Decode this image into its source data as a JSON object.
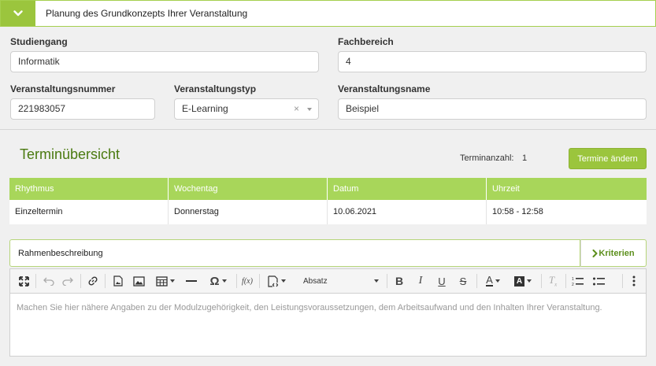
{
  "panel": {
    "title": "Planung des Grundkonzepts Ihrer Veranstaltung",
    "toggle_icon": "chevron-down-icon"
  },
  "form": {
    "studiengang": {
      "label": "Studiengang",
      "value": "Informatik"
    },
    "fachbereich": {
      "label": "Fachbereich",
      "value": "4"
    },
    "veranstaltungsnummer": {
      "label": "Veranstaltungsnummer",
      "value": "221983057"
    },
    "veranstaltungstyp": {
      "label": "Veranstaltungstyp",
      "value": "E-Learning",
      "clear": "×"
    },
    "veranstaltungsname": {
      "label": "Veranstaltungsname",
      "value": "Beispiel"
    }
  },
  "termine": {
    "title": "Terminübersicht",
    "count_label": "Terminanzahl:",
    "count_value": "1",
    "change_button": "Termine ändern",
    "columns": [
      "Rhythmus",
      "Wochentag",
      "Datum",
      "Uhrzeit"
    ],
    "rows": [
      [
        "Einzeltermin",
        "Donnerstag",
        "10.06.2021",
        "10:58 - 12:58"
      ]
    ]
  },
  "rahmen": {
    "title": "Rahmenbeschreibung",
    "criteria_button": "Kriterien",
    "paragraph_format": "Absatz",
    "placeholder": "Machen Sie hier nähere Angaben zu der Modulzugehörigkeit, den Leistungsvoraussetzungen, dem Arbeitsaufwand und den Inhalten Ihrer Veranstaltung."
  },
  "colors": {
    "accent": "#9bc53d",
    "table_header": "#a8d65a",
    "title_green": "#4a7a10"
  }
}
